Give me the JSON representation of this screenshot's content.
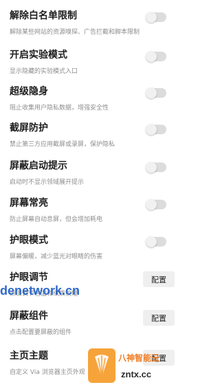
{
  "settings": [
    {
      "title": "解除白名单限制",
      "desc": "解除某些网站的资源嗅探、广告拦截和脚本限制",
      "control": "toggle",
      "enabled": false
    },
    {
      "title": "开启实验模式",
      "desc": "显示隐藏的实验模式入口",
      "control": "toggle",
      "enabled": false
    },
    {
      "title": "超级隐身",
      "desc": "阻止收集用户隐私数据，增强安全性",
      "control": "toggle",
      "enabled": false
    },
    {
      "title": "截屏防护",
      "desc": "禁止第三方应用截屏或录屏，保护隐私",
      "control": "toggle",
      "enabled": false
    },
    {
      "title": "屏蔽启动提示",
      "desc": "启动时不显示领域展开提示",
      "control": "toggle",
      "enabled": false
    },
    {
      "title": "屏幕常亮",
      "desc": "防止屏幕自动息屏，但会增加耗电",
      "control": "toggle",
      "enabled": false
    },
    {
      "title": "护眼模式",
      "desc": "屏幕偏暖，减少蓝光对眼睛的伤害",
      "control": "toggle",
      "enabled": false
    },
    {
      "title": "护眼调节",
      "desc": "点击调节色温和纸质纹理",
      "control": "button",
      "button_label": "配置"
    },
    {
      "title": "屏蔽组件",
      "desc": "点击配置要屏蔽的组件",
      "control": "button",
      "button_label": "配置"
    },
    {
      "title": "主页主题",
      "desc": "自定义 Via 浏览器主页外观",
      "control": "button",
      "button_label": "配置"
    }
  ],
  "watermarks": {
    "left_text": "denetwork.cn",
    "right_brand": "八神智能云",
    "right_domain": "zntx.cc"
  },
  "colors": {
    "toggle_track_off": "#dcdcdc",
    "toggle_knob": "#f1f1f1",
    "button_bg": "#efefef",
    "title_text": "#1e1e1e",
    "desc_text": "#8e8e8e"
  }
}
